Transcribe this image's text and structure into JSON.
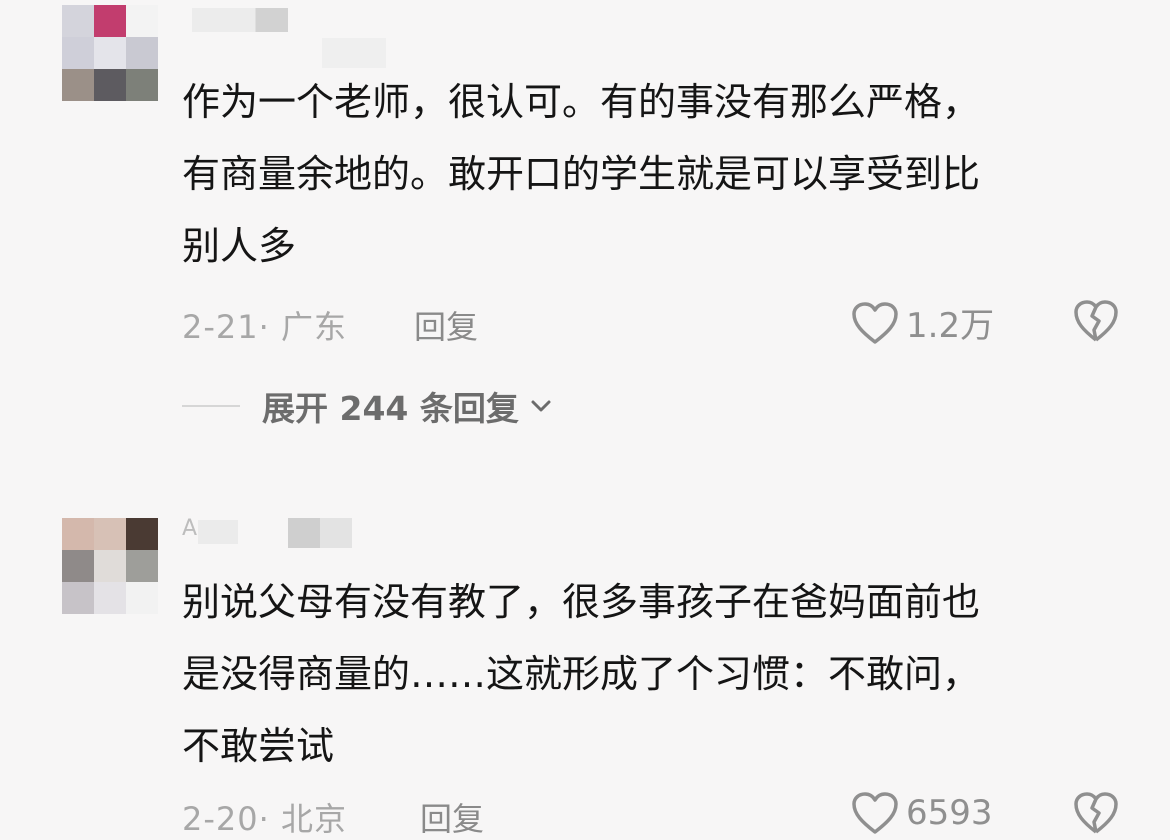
{
  "comments": [
    {
      "text": "作为一个老师，很认可。有的事没有那么严格，\n有商量余地的。敢开口的学生就是可以享受到比\n别人多",
      "meta": "2-21· 广东",
      "reply_label": "回复",
      "likes": "1.2万",
      "expand_label": "展开 244 条回复"
    },
    {
      "username_partial": "A",
      "text": "别说父母有没有教了，很多事孩子在爸妈面前也\n是没得商量的……这就形成了个习惯：不敢问，\n不敢尝试",
      "meta": "2-20· 北京",
      "reply_label": "回复",
      "likes": "6593"
    }
  ],
  "icons": {
    "like": "heart-outline-icon",
    "dislike": "broken-heart-icon",
    "expand": "chevron-down-icon"
  },
  "colors": {
    "background": "#f7f6f6",
    "text": "#151515",
    "meta": "#a7a7a7",
    "icon": "#8f8f8f"
  }
}
